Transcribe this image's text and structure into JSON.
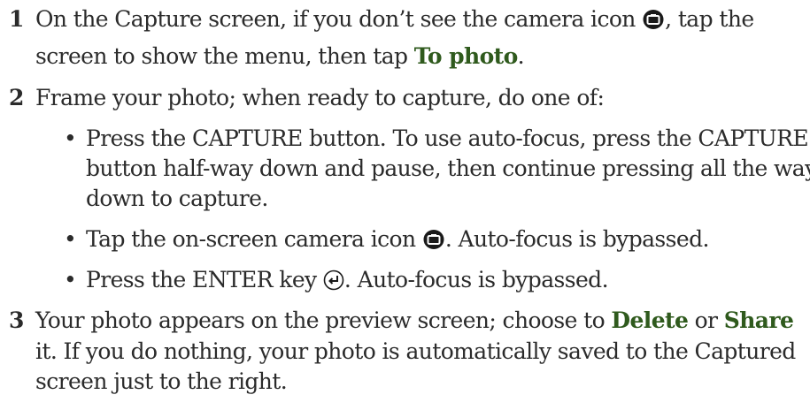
{
  "steps": [
    {
      "number": "1",
      "l1_a": "On the Capture screen, if you don’t see the camera icon",
      "l1_b": ", tap the",
      "l2_a": "screen to show the menu, then tap",
      "l2_kw": "To photo",
      "l2_b": "."
    },
    {
      "number": "2",
      "l1": "Frame your photo; when ready to capture, do one of:",
      "bullets": [
        {
          "lines": [
            "Press the CAPTURE button. To use auto-focus, press the CAPTURE",
            "button half-way down and pause, then continue pressing all the way",
            "down to capture."
          ]
        },
        {
          "a": "Tap the on-screen camera icon",
          "b": ". Auto-focus is bypassed."
        },
        {
          "a": "Press the ENTER key",
          "b": ". Auto-focus is bypassed."
        }
      ]
    },
    {
      "number": "3",
      "l1_a": "Your photo appears on the preview screen; choose to",
      "l1_kw1": "Delete",
      "l1_or": "or",
      "l1_kw2": "Share",
      "l2": "it. If you do nothing, your photo is automatically saved to the Captured",
      "l3": "screen just to the right."
    }
  ],
  "bullet_char": "•",
  "icons": {
    "camera": "camera-icon",
    "enter": "enter-key-icon"
  },
  "colors": {
    "text": "#2b2b2b",
    "keyword": "#2f5a1d"
  }
}
